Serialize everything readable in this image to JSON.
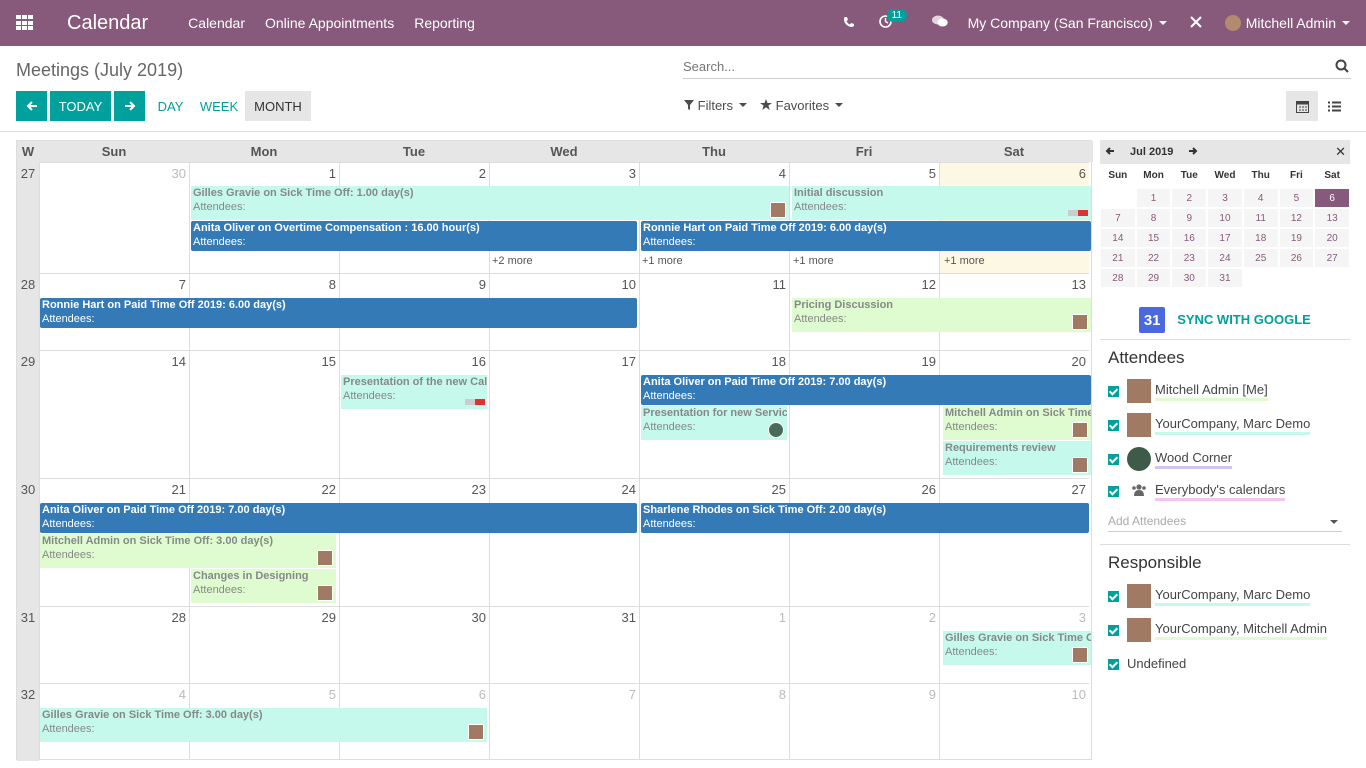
{
  "navbar": {
    "brand": "Calendar",
    "menu": [
      "Calendar",
      "Online Appointments",
      "Reporting"
    ],
    "badge": "11",
    "company": "My Company (San Francisco)",
    "user": "Mitchell Admin"
  },
  "control": {
    "breadcrumb": "Meetings (July 2019)",
    "search_placeholder": "Search...",
    "today": "TODAY",
    "day": "DAY",
    "week": "WEEK",
    "month": "MONTH",
    "filters": "Filters",
    "favorites": "Favorites"
  },
  "calendar": {
    "header": [
      "W",
      "Sun",
      "Mon",
      "Tue",
      "Wed",
      "Thu",
      "Fri",
      "Sat"
    ],
    "weeks": [
      {
        "num": "27",
        "days": [
          "30",
          "1",
          "2",
          "3",
          "4",
          "5",
          "6"
        ]
      },
      {
        "num": "28",
        "days": [
          "7",
          "8",
          "9",
          "10",
          "11",
          "12",
          "13"
        ]
      },
      {
        "num": "29",
        "days": [
          "14",
          "15",
          "16",
          "17",
          "18",
          "19",
          "20"
        ]
      },
      {
        "num": "30",
        "days": [
          "21",
          "22",
          "23",
          "24",
          "25",
          "26",
          "27"
        ]
      },
      {
        "num": "31",
        "days": [
          "28",
          "29",
          "30",
          "31",
          "1",
          "2",
          "3"
        ]
      },
      {
        "num": "32",
        "days": [
          "4",
          "5",
          "6",
          "7",
          "8",
          "9",
          "10"
        ]
      }
    ],
    "attendees_label": "Attendees:",
    "events": [
      {
        "title": "Gilles Gravie on Sick Time Off: 1.00 day(s)"
      },
      {
        "title": "Initial discussion"
      },
      {
        "title": "Anita Oliver on Overtime Compensation : 16.00 hour(s)"
      },
      {
        "title": "Ronnie Hart on Paid Time Off 2019: 6.00 day(s)"
      },
      {
        "title": "Ronnie Hart on Paid Time Off 2019: 6.00 day(s)"
      },
      {
        "title": "Pricing Discussion"
      },
      {
        "title": "Presentation of the new Calendar"
      },
      {
        "title": "Anita Oliver on Paid Time Off 2019: 7.00 day(s)"
      },
      {
        "title": "Presentation for new Services"
      },
      {
        "title": "Mitchell Admin on Sick Time Off"
      },
      {
        "title": "Requirements review"
      },
      {
        "title": "Anita Oliver on Paid Time Off 2019: 7.00 day(s)"
      },
      {
        "title": "Sharlene Rhodes on Sick Time Off: 2.00 day(s)"
      },
      {
        "title": "Mitchell Admin on Sick Time Off: 3.00 day(s)"
      },
      {
        "title": "Changes in Designing"
      },
      {
        "title": "Gilles Gravie on Sick Time Off"
      },
      {
        "title": "Gilles Gravie on Sick Time Off: 3.00 day(s)"
      }
    ],
    "more": [
      "+2 more",
      "+1 more",
      "+1 more",
      "+1 more"
    ]
  },
  "sidebar": {
    "month": "Jul 2019",
    "dow": [
      "Sun",
      "Mon",
      "Tue",
      "Wed",
      "Thu",
      "Fri",
      "Sat"
    ],
    "days": [
      "",
      "1",
      "2",
      "3",
      "4",
      "5",
      "6",
      "7",
      "8",
      "9",
      "10",
      "11",
      "12",
      "13",
      "14",
      "15",
      "16",
      "17",
      "18",
      "19",
      "20",
      "21",
      "22",
      "23",
      "24",
      "25",
      "26",
      "27",
      "28",
      "29",
      "30",
      "31",
      "",
      "",
      ""
    ],
    "selected_day": "6",
    "sync": "SYNC WITH GOOGLE",
    "gcal_number": "31",
    "attendees_title": "Attendees",
    "attendees": [
      "Mitchell Admin [Me]",
      "YourCompany, Marc Demo",
      "Wood Corner",
      "Everybody's calendars"
    ],
    "add_attendees": "Add Attendees",
    "responsible_title": "Responsible",
    "responsible": [
      "YourCompany, Marc Demo",
      "YourCompany, Mitchell Admin",
      "Undefined"
    ]
  }
}
